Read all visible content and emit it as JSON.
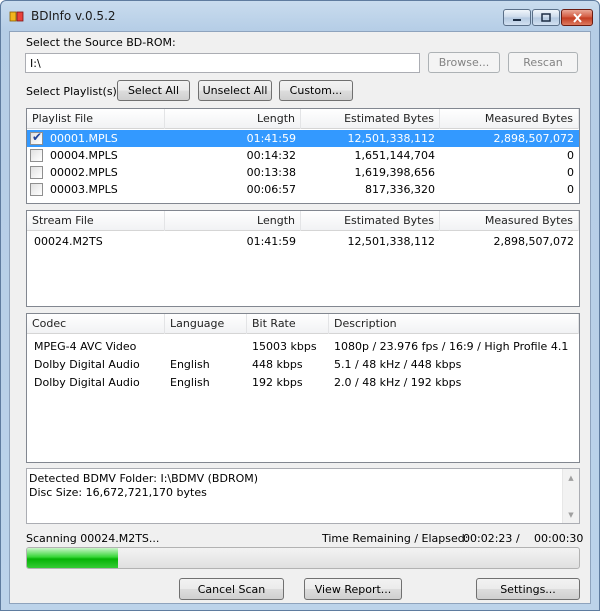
{
  "window": {
    "title": "BDInfo v.0.5.2"
  },
  "source": {
    "label": "Select the Source BD-ROM:",
    "path": "I:\\",
    "browse_label": "Browse...",
    "rescan_label": "Rescan"
  },
  "playlist_select": {
    "label": "Select Playlist(s):",
    "select_all": "Select All",
    "unselect_all": "Unselect All",
    "custom": "Custom..."
  },
  "playlists": {
    "columns": [
      "Playlist File",
      "Length",
      "Estimated Bytes",
      "Measured Bytes"
    ],
    "rows": [
      {
        "file": "00001.MPLS",
        "length": "01:41:59",
        "estimated": "12,501,338,112",
        "measured": "2,898,507,072",
        "checked": true,
        "selected": true
      },
      {
        "file": "00004.MPLS",
        "length": "00:14:32",
        "estimated": "1,651,144,704",
        "measured": "0",
        "checked": false,
        "selected": false
      },
      {
        "file": "00002.MPLS",
        "length": "00:13:38",
        "estimated": "1,619,398,656",
        "measured": "0",
        "checked": false,
        "selected": false
      },
      {
        "file": "00003.MPLS",
        "length": "00:06:57",
        "estimated": "817,336,320",
        "measured": "0",
        "checked": false,
        "selected": false
      }
    ]
  },
  "streams": {
    "columns": [
      "Stream File",
      "Length",
      "Estimated Bytes",
      "Measured Bytes"
    ],
    "rows": [
      {
        "file": "00024.M2TS",
        "length": "01:41:59",
        "estimated": "12,501,338,112",
        "measured": "2,898,507,072"
      }
    ]
  },
  "codecs": {
    "columns": [
      "Codec",
      "Language",
      "Bit Rate",
      "Description"
    ],
    "rows": [
      {
        "codec": "MPEG-4 AVC Video",
        "language": "",
        "bitrate": "15003 kbps",
        "description": "1080p / 23.976 fps / 16:9 / High Profile 4.1"
      },
      {
        "codec": "Dolby Digital Audio",
        "language": "English",
        "bitrate": "448 kbps",
        "description": "5.1 / 48 kHz / 448 kbps"
      },
      {
        "codec": "Dolby Digital Audio",
        "language": "English",
        "bitrate": "192 kbps",
        "description": "2.0 / 48 kHz / 192 kbps"
      }
    ]
  },
  "info": {
    "line1": "Detected BDMV Folder: I:\\BDMV (BDROM)",
    "line2": "Disc Size: 16,672,721,170 bytes"
  },
  "status": {
    "scanning": "Scanning 00024.M2TS...",
    "time_label": "Time Remaining / Elapsed:",
    "remaining": "00:02:23",
    "separator": "/",
    "elapsed": "00:00:30",
    "progress_fraction": 0.165
  },
  "actions": {
    "cancel_scan": "Cancel Scan",
    "view_report": "View Report...",
    "settings": "Settings..."
  },
  "colors": {
    "selection": "#3399ff",
    "progress_green": "#06b306",
    "close_red": "#c23a1f"
  }
}
